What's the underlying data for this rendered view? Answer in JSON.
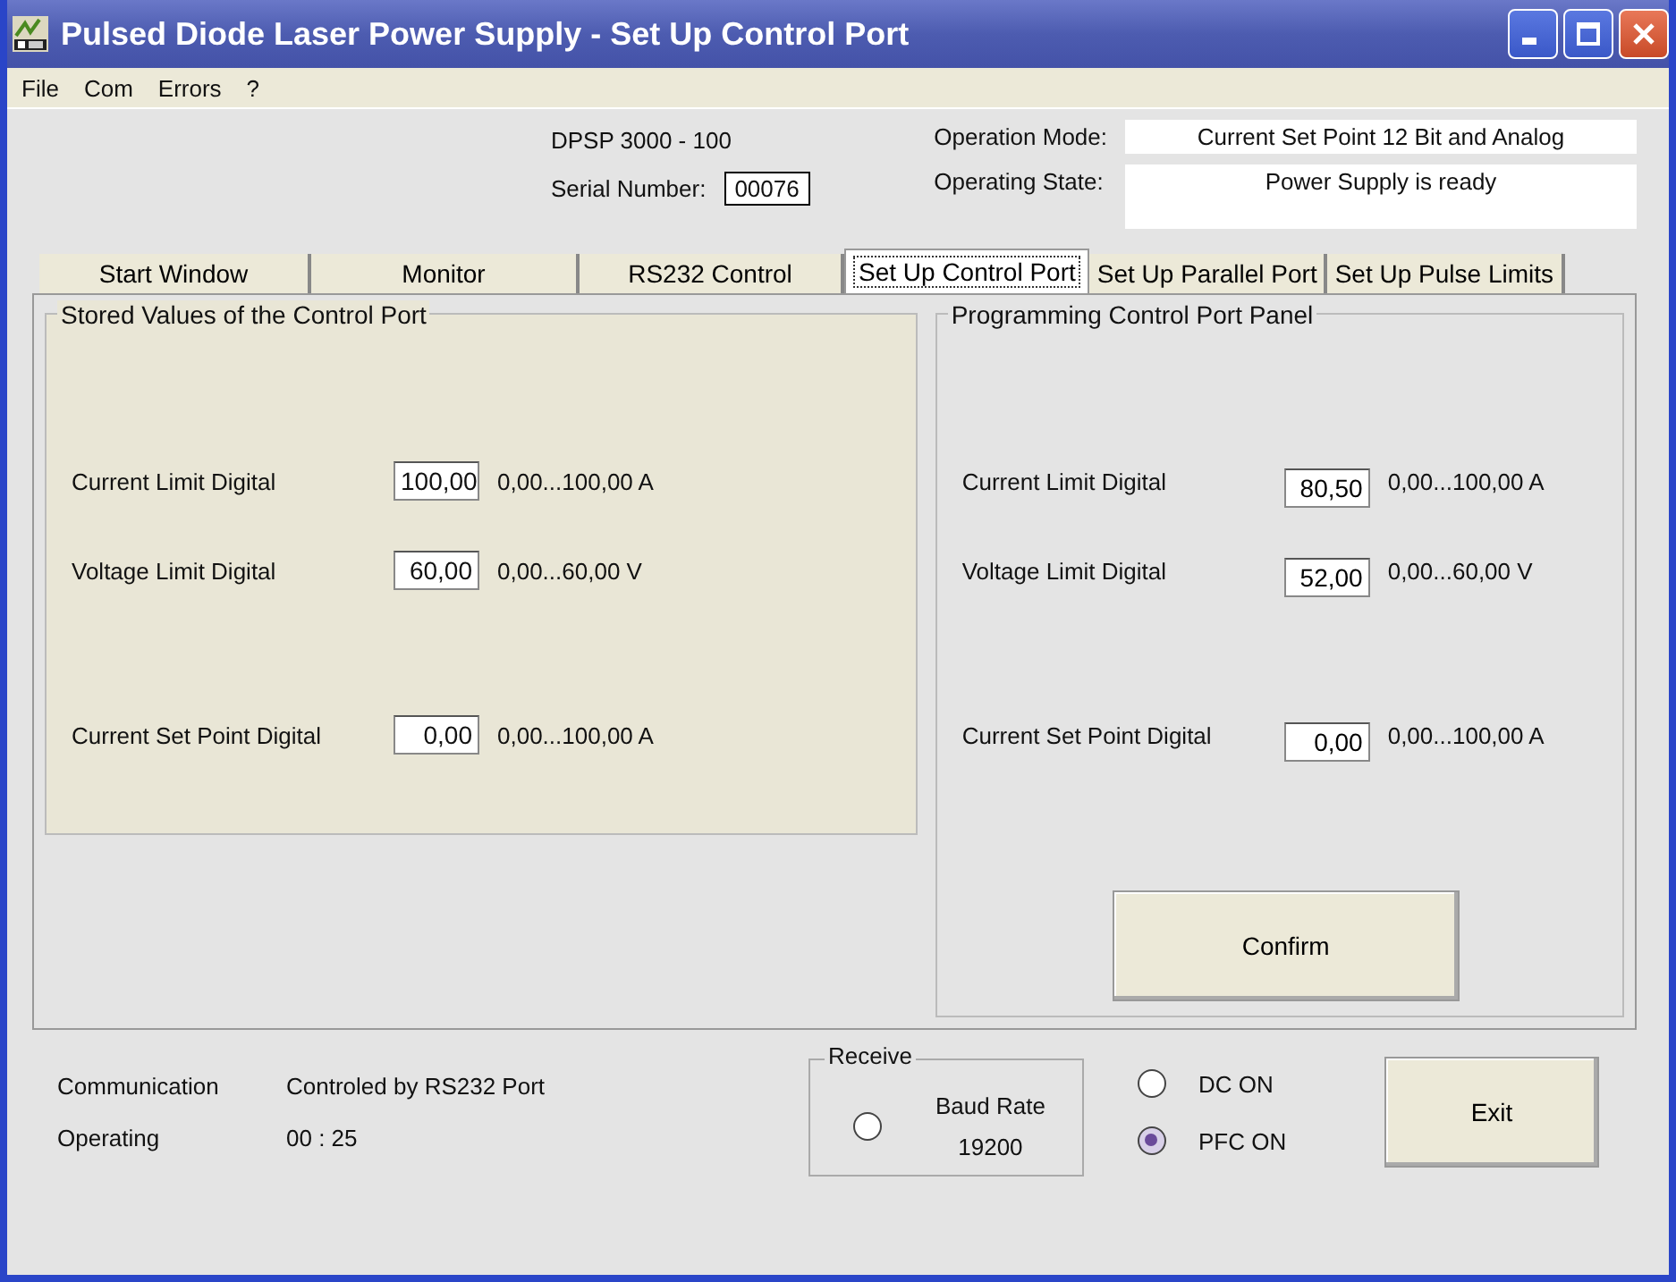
{
  "window": {
    "title": "Pulsed Diode Laser Power Supply - Set Up Control Port"
  },
  "menu": [
    "File",
    "Com",
    "Errors",
    "?"
  ],
  "header": {
    "model": "DPSP  3000  -  100",
    "serial_label": "Serial Number:",
    "serial": "00076",
    "mode_label": "Operation Mode:",
    "mode": "Current Set Point 12 Bit and Analog",
    "state_label": "Operating State:",
    "state": "Power Supply is ready"
  },
  "tabs": [
    {
      "label": "Start Window",
      "selected": false
    },
    {
      "label": "Monitor",
      "selected": false
    },
    {
      "label": "RS232 Control",
      "selected": false
    },
    {
      "label": "Set Up Control Port",
      "selected": true
    },
    {
      "label": "Set Up Parallel Port",
      "selected": false
    },
    {
      "label": "Set Up Pulse Limits",
      "selected": false
    }
  ],
  "stored": {
    "title": "Stored Values of the Control Port",
    "rows": [
      {
        "label": "Current Limit Digital",
        "value": "100,00",
        "range": "0,00...100,00 A"
      },
      {
        "label": "Voltage Limit Digital",
        "value": "60,00",
        "range": "0,00...60,00 V"
      },
      {
        "label": "Current Set Point Digital",
        "value": "0,00",
        "range": "0,00...100,00 A"
      }
    ]
  },
  "programming": {
    "title": "Programming Control Port Panel",
    "rows": [
      {
        "label": "Current Limit Digital",
        "value": "80,50",
        "range": "0,00...100,00 A"
      },
      {
        "label": "Voltage Limit Digital",
        "value": "52,00",
        "range": "0,00...60,00 V"
      },
      {
        "label": "Current Set Point Digital",
        "value": "0,00",
        "range": "0,00...100,00 A"
      }
    ],
    "confirm": "Confirm"
  },
  "status": [
    {
      "label": "Communication",
      "value": "Controled by RS232 Port"
    },
    {
      "label": "Operating",
      "value": "00 : 25"
    }
  ],
  "receive": {
    "title": "Receive",
    "on": false,
    "baud_label": "Baud Rate",
    "baud": "19200"
  },
  "radios": [
    {
      "label": "DC ON",
      "checked": false
    },
    {
      "label": "PFC ON",
      "checked": true
    }
  ],
  "exit": "Exit"
}
